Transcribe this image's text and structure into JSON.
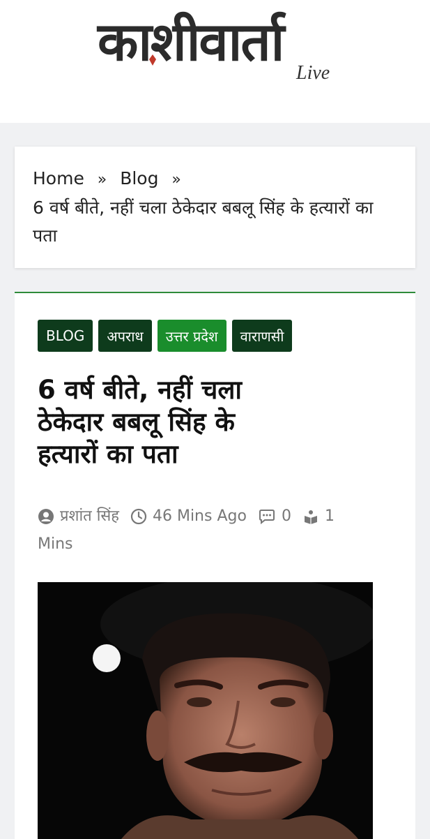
{
  "header": {
    "logo_text": "काशीवार्ता",
    "logo_sub": "Live",
    "colors": {
      "logo_text": "#2b2b2b",
      "nib_accent": "#c0392b"
    }
  },
  "breadcrumb": {
    "home": "Home",
    "blog": "Blog",
    "separator": "»",
    "current_line1": "6 वर्ष बीते, नहीं चला ठेकेदार बबलू सिंह के हत्यारों का",
    "current_line2": "पता"
  },
  "article": {
    "tags": [
      {
        "label": "BLOG"
      },
      {
        "label": "अपराध"
      },
      {
        "label": "उत्तर प्रदेश"
      },
      {
        "label": "वाराणसी"
      }
    ],
    "title_lines": [
      "6 वर्ष बीते, नहीं चला",
      "ठेकेदार बबलू सिंह के",
      "हत्यारों का पता"
    ],
    "meta": {
      "author": "प्रशांत सिंह",
      "time": "46 Mins Ago",
      "comments": "0",
      "read_value": "1",
      "read_unit": "Mins",
      "icons": [
        "user-icon",
        "clock-icon",
        "comment-icon",
        "reading-icon"
      ]
    },
    "colors": {
      "tag_dark": "#0e3b1c",
      "tag_green": "#1a8d2c",
      "top_border": "#2e8b3a"
    }
  }
}
